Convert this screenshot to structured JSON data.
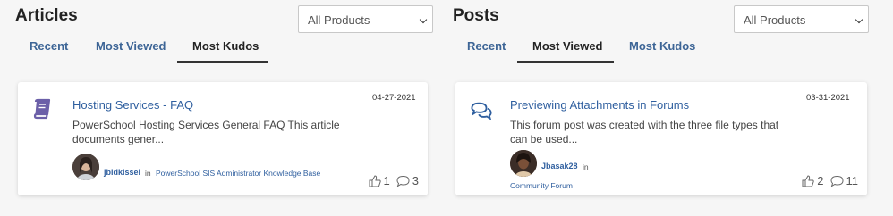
{
  "articles": {
    "title": "Articles",
    "filter": "All Products",
    "tabs": [
      "Recent",
      "Most Viewed",
      "Most Kudos"
    ],
    "active_tab": 2,
    "card": {
      "icon": "book-icon",
      "date": "04-27-2021",
      "title": "Hosting Services - FAQ",
      "body": "PowerSchool Hosting Services General FAQ This article documents gener...",
      "author": "jbidkissel",
      "in": "in",
      "place": "PowerSchool SIS Administrator Knowledge Base",
      "kudos": "1",
      "comments": "3"
    }
  },
  "posts": {
    "title": "Posts",
    "filter": "All Products",
    "tabs": [
      "Recent",
      "Most Viewed",
      "Most Kudos"
    ],
    "active_tab": 1,
    "card": {
      "icon": "chat-bubbles-icon",
      "date": "03-31-2021",
      "title": "Previewing Attachments in Forums",
      "body": "This forum post was created with the three file types that can be used...",
      "author": "Jbasak28",
      "in": "in",
      "place": "Community Forum",
      "kudos": "2",
      "comments": "11"
    }
  },
  "colors": {
    "link": "#2f5f9f",
    "tab": "#3d6596",
    "icon": "#6b5fa8"
  }
}
